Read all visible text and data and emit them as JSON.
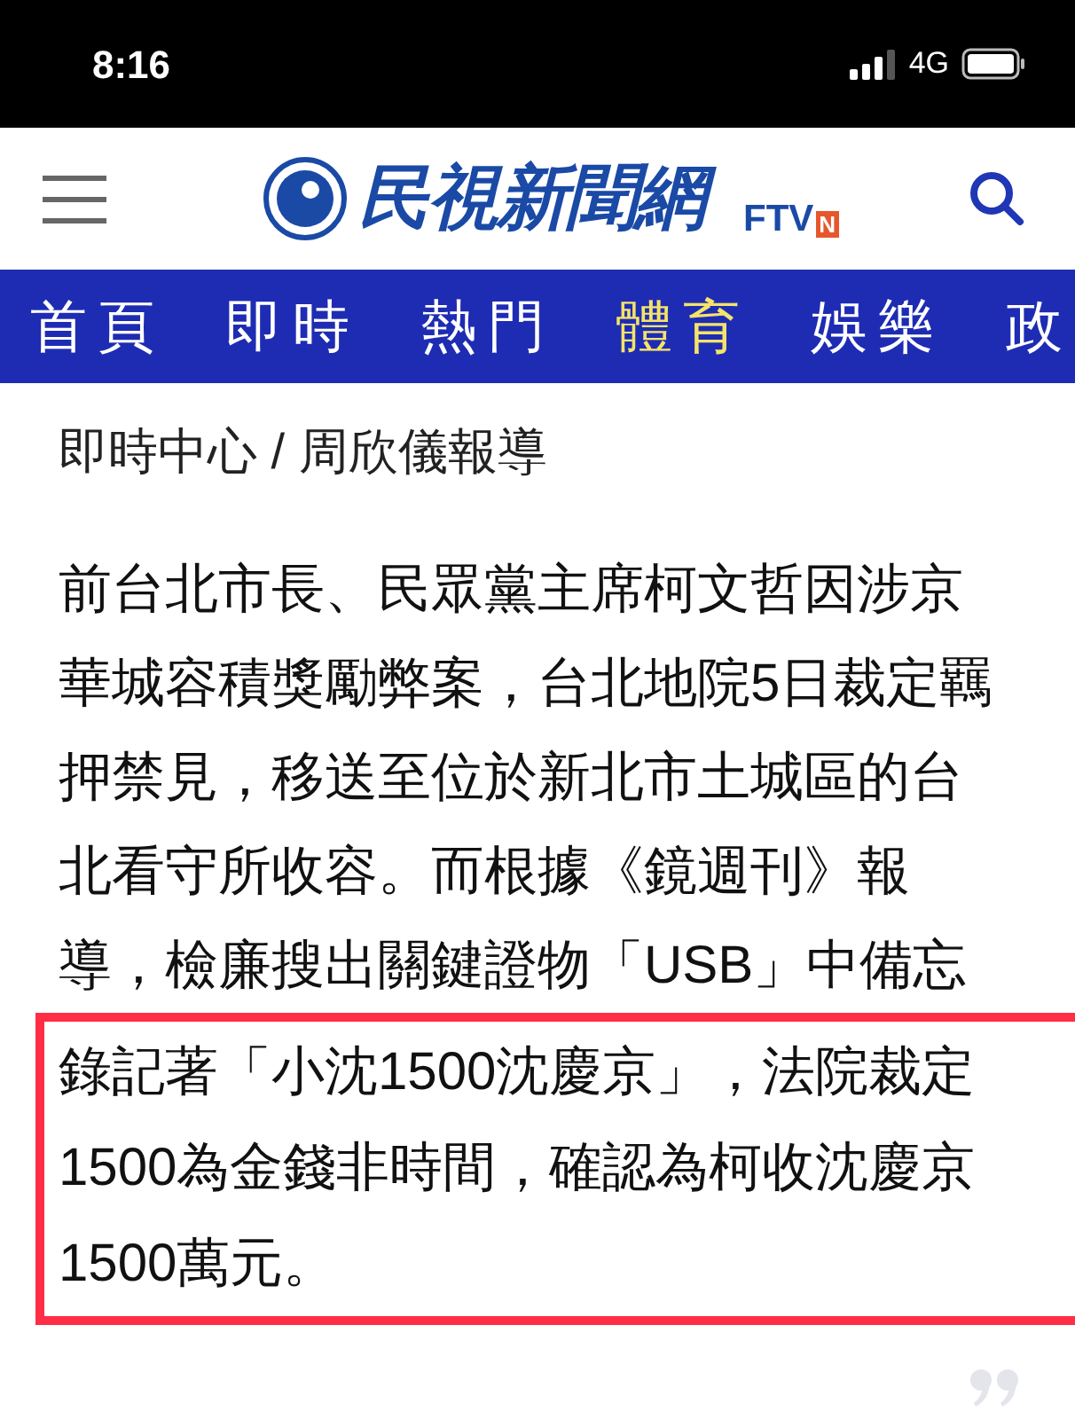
{
  "status_bar": {
    "time": "8:16",
    "network": "4G"
  },
  "header": {
    "logo_text": "民視新聞網",
    "logo_brand": "FTV",
    "logo_badge": "N"
  },
  "nav_tabs": [
    {
      "label": "首頁",
      "selected": false
    },
    {
      "label": "即時",
      "selected": false
    },
    {
      "label": "熱門",
      "selected": false
    },
    {
      "label": "體育",
      "selected": true
    },
    {
      "label": "娛樂",
      "selected": false
    },
    {
      "label": "政",
      "selected": false
    }
  ],
  "article": {
    "byline": "即時中心 / 周欣儀報導",
    "blocks": [
      {
        "lines": [
          "前台北市長、民眾黨主席柯文哲因涉京",
          "華城容積獎勵弊案，台北地院5日裁定羈",
          "押禁見，移送至位於新北市土城區的台",
          "北看守所收容。而根據《鏡週刊》報",
          "導，檢廉搜出關鍵證物「USB」中備忘"
        ],
        "highlighted": false
      },
      {
        "lines": [
          "錄記著「小沈1500沈慶京」，法院裁定",
          "1500為金錢非時間，確認為柯收沈慶京",
          "1500萬元。"
        ],
        "highlighted": true
      }
    ]
  }
}
